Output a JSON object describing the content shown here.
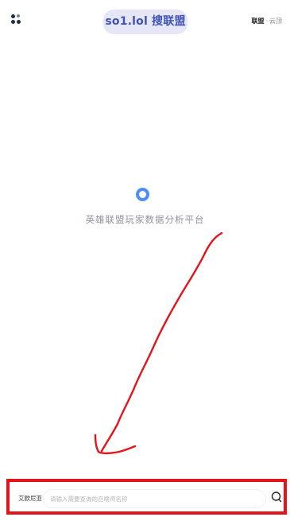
{
  "header": {
    "menu_icon": "grid-dots-icon",
    "site_title": "so1.lol 搜联盟",
    "game_switch": {
      "active": "联盟",
      "separator": "·",
      "other": "云顶"
    }
  },
  "main": {
    "loading_icon": "loading-ring-icon",
    "tagline": "英雄联盟玩家数据分析平台"
  },
  "search": {
    "region": "艾欧尼亚",
    "placeholder": "请输入需要查询的召唤师名称",
    "button_icon": "search-icon"
  },
  "colors": {
    "accent": "#3f51b5",
    "badge_bg": "#e6e7f6",
    "loader": "#4e8ff5",
    "annotation": "#e3151b"
  }
}
